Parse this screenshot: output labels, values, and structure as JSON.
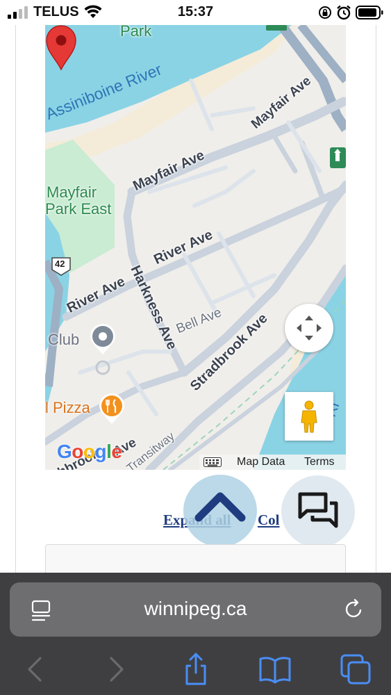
{
  "status_bar": {
    "carrier": "TELUS",
    "time": "15:37"
  },
  "map": {
    "water_labels": [
      "Assiniboine River",
      "Ri"
    ],
    "park_labels": [
      "Park",
      "Mayfair",
      "Park East"
    ],
    "street_labels": [
      "Mayfair Ave",
      "Mayfair Ave",
      "River Ave",
      "River Ave",
      "Harkness Ave",
      "Bell Ave",
      "Stradbrook Ave",
      "Transitway",
      "Ave",
      "hbrook"
    ],
    "route_shield": "42",
    "poi_labels": [
      "Club",
      "l Pizza"
    ],
    "google_logo": "Google",
    "attribution": {
      "map_data": "Map Data",
      "terms": "Terms"
    },
    "colors": {
      "water": "#8ad3e5",
      "park": "#c9ecd3",
      "road": "#c9d2dd",
      "pin": "#e53935",
      "pizza": "#f3911f",
      "poi_grey": "#7f8a98"
    }
  },
  "links": {
    "expand_all": "Expand all",
    "collapse_all": "Col"
  },
  "browser": {
    "url": "winnipeg.ca",
    "colors": {
      "toolbar": "#3f3f42",
      "urlbar": "#6e6e71",
      "active_icon": "#4a8ef5",
      "disabled_icon": "#6b6b6e"
    }
  }
}
